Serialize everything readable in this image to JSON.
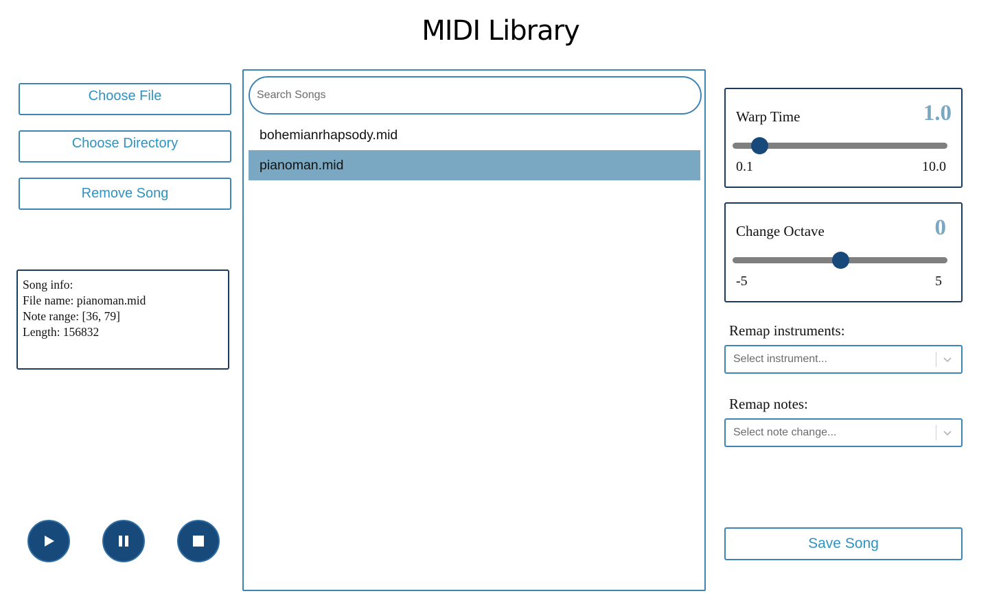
{
  "app": {
    "title": "MIDI Library"
  },
  "sidebar": {
    "choose_file_label": "Choose File",
    "choose_directory_label": "Choose Directory",
    "remove_song_label": "Remove Song"
  },
  "song_info": {
    "heading": "Song info:",
    "file_name": "File name: pianoman.mid",
    "note_range": "Note range: [36, 79]",
    "length": "Length: 156832"
  },
  "playback": {
    "play_icon": "play-icon",
    "pause_icon": "pause-icon",
    "stop_icon": "stop-icon"
  },
  "library": {
    "search_placeholder": "Search Songs",
    "search_value": "",
    "songs": [
      {
        "name": "bohemianrhapsody.mid",
        "selected": false
      },
      {
        "name": "pianoman.mid",
        "selected": true
      }
    ]
  },
  "warp_time": {
    "label": "Warp Time",
    "value": "1.0",
    "min": "0.1",
    "max": "10.0",
    "position_fraction": 0.125
  },
  "change_octave": {
    "label": "Change Octave",
    "value": "0",
    "min": "-5",
    "max": "5",
    "position_fraction": 0.5
  },
  "remap_instruments": {
    "label": "Remap instruments:",
    "placeholder": "Select instrument..."
  },
  "remap_notes": {
    "label": "Remap notes:",
    "placeholder": "Select note change..."
  },
  "save_label": "Save Song",
  "colors": {
    "accent": "#3d83b3",
    "button_text": "#2e92c2",
    "dark": "#17497a",
    "selected_row": "#7aa8c2"
  }
}
